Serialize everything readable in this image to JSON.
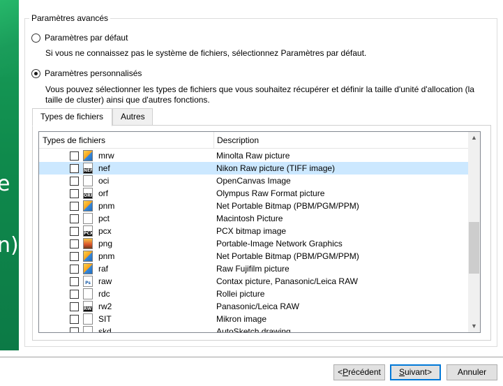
{
  "group_title": "Paramètres avancés",
  "default_option": {
    "label": "Paramètres par défaut",
    "description": "Si vous ne connaissez pas le système de fichiers, sélectionnez Paramètres par défaut.",
    "checked": false
  },
  "custom_option": {
    "label": "Paramètres personnalisés",
    "description_line1": "Vous pouvez sélectionner les types de fichiers que vous souhaitez récupérer et définir la taille d'unité d'allocation (la",
    "description_line2": "taille de cluster) ainsi que d'autres fonctions.",
    "checked": true
  },
  "tabs": [
    {
      "label": "Types de fichiers",
      "active": true
    },
    {
      "label": "Autres",
      "active": false
    }
  ],
  "columns": {
    "type": "Types de fichiers",
    "description": "Description"
  },
  "rows": [
    {
      "ext": "mrw",
      "description": "Minolta Raw picture",
      "icon": "image-file-icon",
      "icon_text": "",
      "selected": false
    },
    {
      "ext": "nef",
      "description": "Nikon Raw picture (TIFF image)",
      "icon": "nef-file-icon",
      "icon_text": "NEF",
      "selected": true
    },
    {
      "ext": "oci",
      "description": "OpenCanvas Image",
      "icon": "blank-file-icon",
      "icon_text": "",
      "selected": false
    },
    {
      "ext": "orf",
      "description": "Olympus Raw Format picture",
      "icon": "orf-file-icon",
      "icon_text": "ORF",
      "selected": false
    },
    {
      "ext": "pnm",
      "description": "Net Portable Bitmap (PBM/PGM/PPM)",
      "icon": "image-file-icon",
      "icon_text": "",
      "selected": false
    },
    {
      "ext": "pct",
      "description": "Macintosh Picture",
      "icon": "blank-file-icon",
      "icon_text": "",
      "selected": false
    },
    {
      "ext": "pcx",
      "description": "PCX bitmap image",
      "icon": "pcx-file-icon",
      "icon_text": "PCX",
      "selected": false
    },
    {
      "ext": "png",
      "description": "Portable-Image Network Graphics",
      "icon": "photo-file-icon",
      "icon_text": "",
      "selected": false
    },
    {
      "ext": "pnm",
      "description": "Net Portable Bitmap (PBM/PGM/PPM)",
      "icon": "image-file-icon",
      "icon_text": "",
      "selected": false
    },
    {
      "ext": "raf",
      "description": "Raw Fujifilm picture",
      "icon": "image-file-icon",
      "icon_text": "",
      "selected": false
    },
    {
      "ext": "raw",
      "description": "Contax picture, Panasonic/Leica RAW",
      "icon": "photoshop-file-icon",
      "icon_text": "Ps",
      "selected": false
    },
    {
      "ext": "rdc",
      "description": "Rollei picture",
      "icon": "blank-file-icon",
      "icon_text": "",
      "selected": false
    },
    {
      "ext": "rw2",
      "description": "Panasonic/Leica RAW",
      "icon": "rw2-file-icon",
      "icon_text": "RW2",
      "selected": false
    },
    {
      "ext": "SIT",
      "description": "Mikron image",
      "icon": "blank-file-icon",
      "icon_text": "",
      "selected": false
    },
    {
      "ext": "skd",
      "description": "AutoSketch drawing",
      "icon": "blank-file-icon",
      "icon_text": "",
      "selected": false
    }
  ],
  "buttons": {
    "previous": {
      "underlined": "P",
      "rest": "récédent",
      "prefix": "<",
      "suffix": ""
    },
    "next": {
      "underlined": "S",
      "rest": "uivant",
      "prefix": "",
      "suffix": ">"
    },
    "cancel": {
      "label": "Annuler"
    }
  },
  "colors": {
    "selection": "#cce8ff",
    "accent": "#0078d7",
    "banner": "#19a05a"
  }
}
